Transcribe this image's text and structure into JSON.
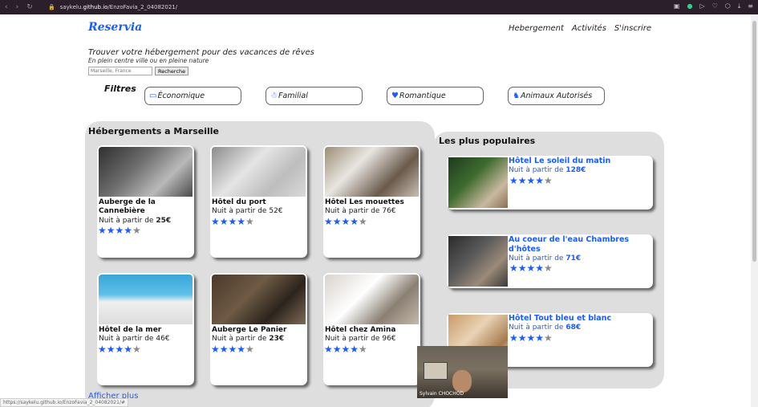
{
  "browser": {
    "url_prefix": "saykelu.",
    "url_domain": "github.io",
    "url_path": "/EnzoFavia_2_04082021/",
    "status_url": "https://saykelu.github.io/EnzoFavia_2_04082021/#"
  },
  "site": {
    "logo": "Reservia",
    "nav": [
      "Hebergement",
      "Activités",
      "S'inscrire"
    ]
  },
  "search": {
    "title": "Trouver votre hébergement pour des vacances de rêves",
    "subtitle": "En plein centre ville ou en pleine nature",
    "placeholder": "Marseille, France",
    "button": "Recherche"
  },
  "filters": {
    "title": "Filtres",
    "items": [
      {
        "label": "Économique",
        "icon": "money-icon"
      },
      {
        "label": "Familial",
        "icon": "family-icon"
      },
      {
        "label": "Romantique",
        "icon": "heart-icon"
      },
      {
        "label": "Animaux Autorisés",
        "icon": "dog-icon"
      }
    ]
  },
  "listings": {
    "title": "Hébergements a Marseille",
    "price_prefix": "Nuit à partir de ",
    "more": "Afficher plus",
    "items": [
      {
        "name": "Auberge de la Cannebière",
        "price": "25€",
        "rating": 4,
        "bold_price": true
      },
      {
        "name": "Hôtel du port",
        "price": "52€",
        "rating": 4,
        "bold_price": false
      },
      {
        "name": "Hôtel Les mouettes",
        "price": "76€",
        "rating": 4,
        "bold_price": false
      },
      {
        "name": "Hôtel de la mer",
        "price": "46€",
        "rating": 4,
        "bold_price": false
      },
      {
        "name": "Auberge Le Panier",
        "price": "23€",
        "rating": 4,
        "bold_price": true
      },
      {
        "name": "Hôtel chez Amina",
        "price": "96€",
        "rating": 4,
        "bold_price": false
      }
    ]
  },
  "popular": {
    "title": "Les plus populaires",
    "items": [
      {
        "name": "Hôtel Le soleil du matin",
        "price": "128€",
        "rating": 4
      },
      {
        "name": "Au coeur de l'eau Chambres d'hôtes",
        "price": "71€",
        "rating": 4
      },
      {
        "name": "Hôtel Tout bleu et blanc",
        "price": "68€",
        "rating": 4
      }
    ]
  },
  "webcam": {
    "name": "Sylvain CHOCHOD"
  },
  "colors": {
    "accent": "#1a5cff",
    "panel": "#dedede",
    "star_off": "#8a8a8a"
  }
}
